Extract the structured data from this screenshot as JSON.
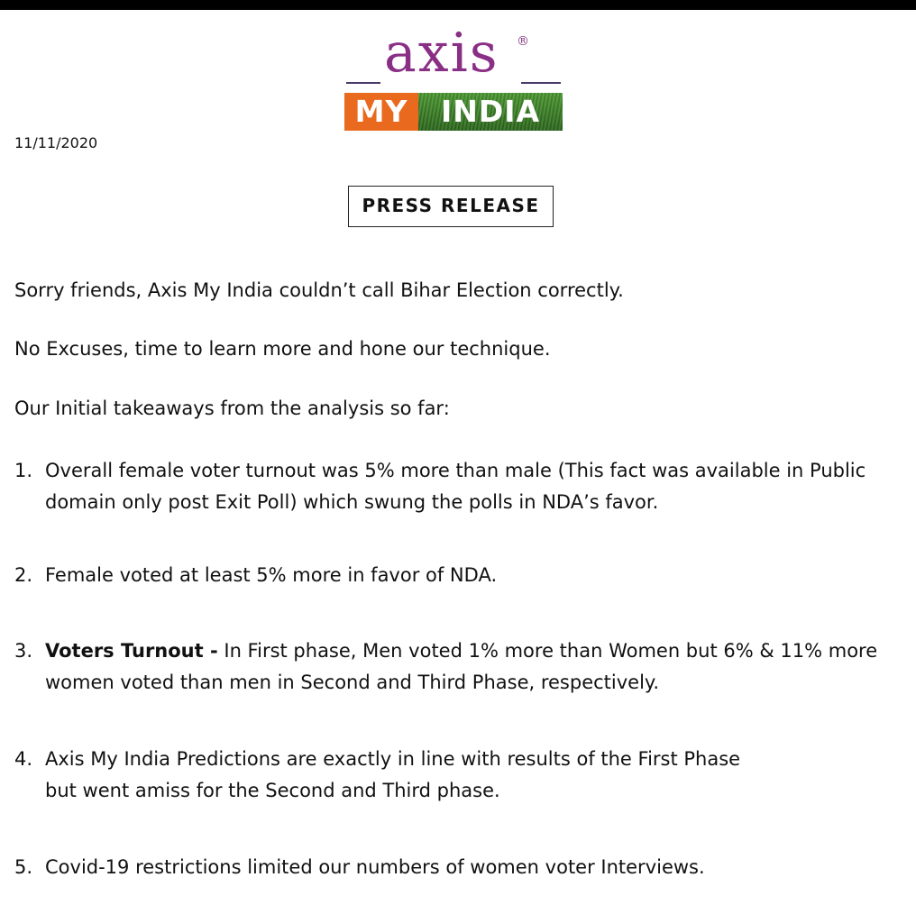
{
  "logo": {
    "axis": "axis",
    "registered": "®",
    "band_left": "MY",
    "band_right": "INDIA"
  },
  "date": "11/11/2020",
  "press_release": "PRESS RELEASE",
  "paragraphs": [
    "Sorry friends, Axis My India couldn’t call Bihar Election correctly.",
    "No Excuses, time to learn more and hone our technique.",
    "Our Initial takeaways from the analysis so far:"
  ],
  "items": [
    {
      "number": "1.",
      "lines": [
        "Overall female voter turnout was 5% more than male (This fact was available in Public",
        "domain only post Exit Poll) which swung the polls in NDA’s favor."
      ]
    },
    {
      "number": "2.",
      "lines": [
        "Female voted at least 5% more in favor of NDA."
      ]
    },
    {
      "number": "3.",
      "bold_lead": "Voters Turnout -",
      "lines": [
        " In First phase, Men voted 1% more than Women but 6% & 11% more",
        "women voted than men in Second and Third Phase, respectively."
      ]
    },
    {
      "number": "4.",
      "lines": [
        "Axis My India Predictions are exactly in line with results of the First Phase",
        "but went amiss for the Second and Third phase."
      ]
    },
    {
      "number": "5.",
      "lines": [
        "Covid-19 restrictions limited our numbers of women voter Interviews."
      ]
    }
  ]
}
